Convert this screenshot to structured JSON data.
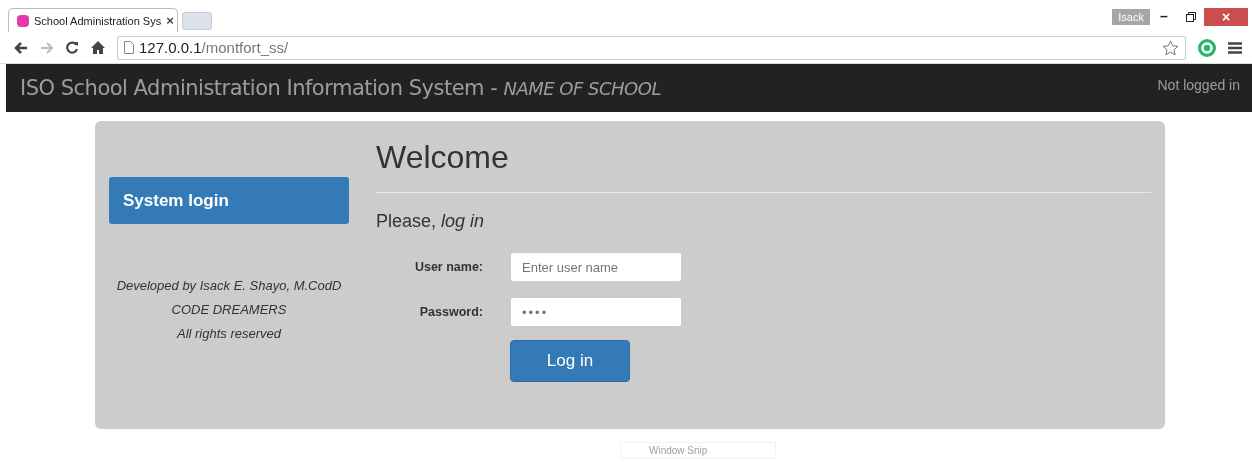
{
  "browser": {
    "tab_title": "School Administration Sys",
    "tab_close": "×",
    "user": "Isack",
    "window_controls": [
      "–",
      "×"
    ],
    "url_host": "127.0.0.1",
    "url_path": "/montfort_ss/"
  },
  "navbar": {
    "title": "ISO School Administration Information System - ",
    "school": "NAME OF SCHOOL",
    "status": "Not logged in"
  },
  "sidebar": {
    "heading": "System login",
    "credits": [
      "Developed by Isack E. Shayo, M.CodD",
      "CODE DREAMERS",
      "All rights reserved"
    ]
  },
  "main": {
    "title": "Welcome",
    "subtitle": "Please, *log in*",
    "fields": [
      {
        "label": "User name:",
        "placeholder": "Enter user name",
        "kind": "text"
      },
      {
        "label": "Password:",
        "placeholder": "••••",
        "kind": "password"
      }
    ],
    "button": "Log in"
  },
  "overlay": {
    "label": "Window Snip"
  }
}
